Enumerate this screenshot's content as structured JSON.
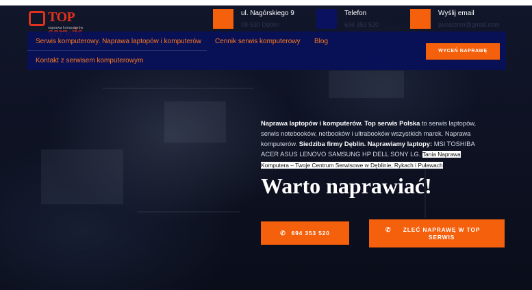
{
  "logo": {
    "text": "TOP serwis",
    "tagline": "naprawa komputerów"
  },
  "contact": [
    {
      "title": "ul. Nagórskiego 9",
      "value": "08-530 Dęblin",
      "icon": "location-icon"
    },
    {
      "title": "Telefon",
      "value": "694 353 520",
      "icon": "phone-icon"
    },
    {
      "title": "Wyślij email",
      "value": "punatcom@gmail.com",
      "icon": "email-icon"
    }
  ],
  "nav": {
    "items": [
      "Serwis komputerowy. Naprawa laptopów i komputerów",
      "Cennik serwis komputerowy",
      "Blog",
      "Kontakt z serwisem komputerowym"
    ],
    "cta": "WYCEŃ NAPRAWĘ"
  },
  "hero": {
    "p1_bold": "Naprawa laptopów i komputerów. Top serwis Polska",
    "p1_text": " to serwis laptopów, serwis notebooków, netbooków i ultrabooków wszystkich marek. Naprawa komputerów. ",
    "p2_bold": "Siedziba firmy Dęblin. Naprawiamy laptopy:",
    "p2_text": " MSI TOSHIBA ACER ASUS LENOVO SAMSUNG HP DELL SONY LG. ",
    "highlight": "Tania Naprawa Komputera – Twoje Centrum Serwisowe w Dęblinie, Rykach i Puławach",
    "headline": "Warto naprawiać!",
    "btn_phone": "694 353 520",
    "btn_order": "ZLEĆ NAPRAWĘ W TOP SERWIS"
  },
  "colors": {
    "accent": "#f4600c",
    "nav_bg": "#08105a",
    "logo_red": "#e0321e"
  }
}
